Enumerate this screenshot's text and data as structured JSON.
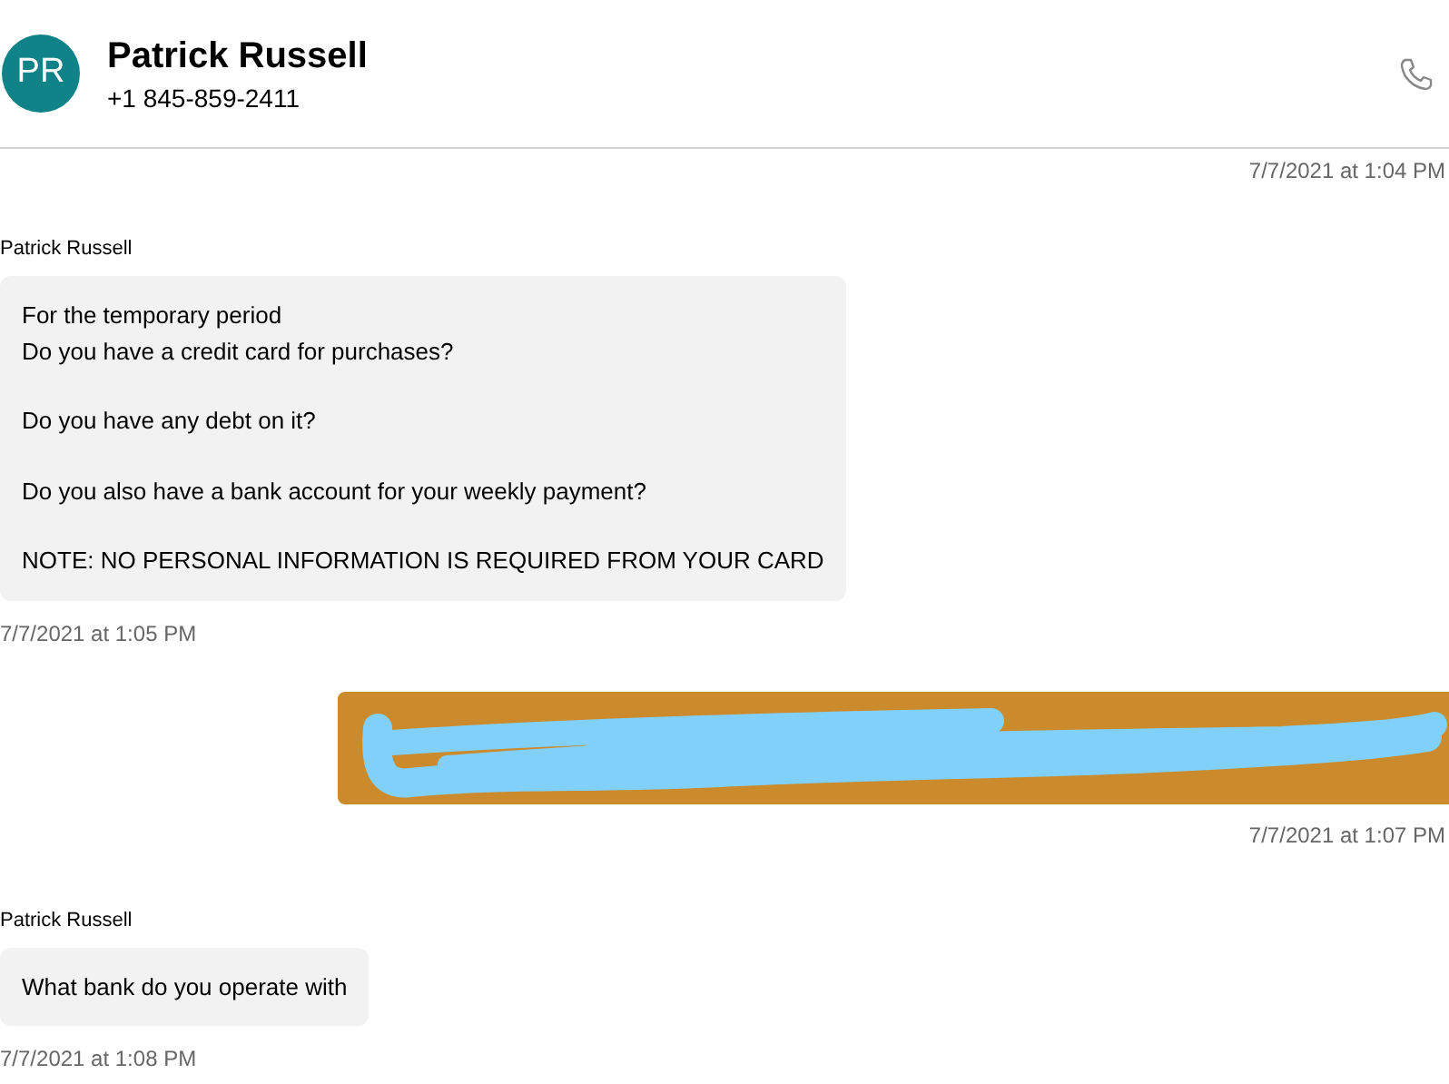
{
  "header": {
    "avatar_initials": "PR",
    "name": "Patrick Russell",
    "phone": "+1 845-859-2411"
  },
  "items": [
    {
      "kind": "timestamp",
      "time": "7/7/2021 at 1:04 PM"
    },
    {
      "kind": "incoming",
      "sender": "Patrick Russell",
      "paragraphs": [
        "For the temporary period\nDo you have a credit card for purchases?",
        "Do you have any debt on it?",
        "Do you also have a bank account for your weekly payment?",
        "NOTE: NO PERSONAL INFORMATION IS REQUIRED FROM YOUR CARD"
      ],
      "time": "7/7/2021 at 1:05 PM"
    },
    {
      "kind": "outgoing_redacted",
      "time": "7/7/2021 at 1:07 PM"
    },
    {
      "kind": "incoming",
      "sender": "Patrick Russell",
      "paragraphs": [
        "What bank do you operate with"
      ],
      "time": "7/7/2021 at 1:08 PM"
    }
  ]
}
